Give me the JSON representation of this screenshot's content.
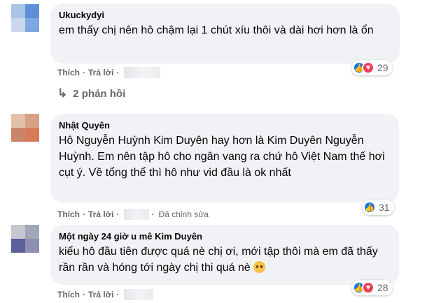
{
  "comments": [
    {
      "author": "Ukuckydyi",
      "text": "em thấy chị nên hô chậm lại 1 chút xíu thôi và dài hơi hơn là ổn",
      "actions": {
        "like": "Thích",
        "reply": "Trả lời"
      },
      "reactions": {
        "icons": [
          "like-icon",
          "love-icon"
        ],
        "count": "29"
      },
      "reply_toggle": "2 phản hồi"
    },
    {
      "author": "Nhật Quyên",
      "text": "Hô Nguyễn Huỳnh Kim Duyên hay hơn là Kim Duyên Nguyễn Huỳnh. Em nên tập hô cho ngân vang ra chứ hô Việt Nam thế hơi cụt ý. Về tổng thể thì hô như vid đầu là ok nhất",
      "actions": {
        "like": "Thích",
        "reply": "Trả lời",
        "edited": "Đã chỉnh sửa"
      },
      "reactions": {
        "icons": [
          "like-icon"
        ],
        "count": "31"
      }
    },
    {
      "author": "Một ngày 24 giờ u mê Kim Duyên",
      "text": "kiểu hô đầu tiên được quá nè chị ơi, mới tập thôi mà em đã thấy rần rần và hóng tới ngày chị thi quá nè",
      "emoji": "sad-face-emoji",
      "actions": {
        "like": "Thích",
        "reply": "Trả lời"
      },
      "reactions": {
        "icons": [
          "like-icon",
          "love-icon"
        ],
        "count": "28"
      }
    }
  ],
  "colors": {
    "bubble": "#f0f2f5",
    "meta": "#65676b",
    "like": "#1b74e4",
    "love": "#f33e58"
  }
}
